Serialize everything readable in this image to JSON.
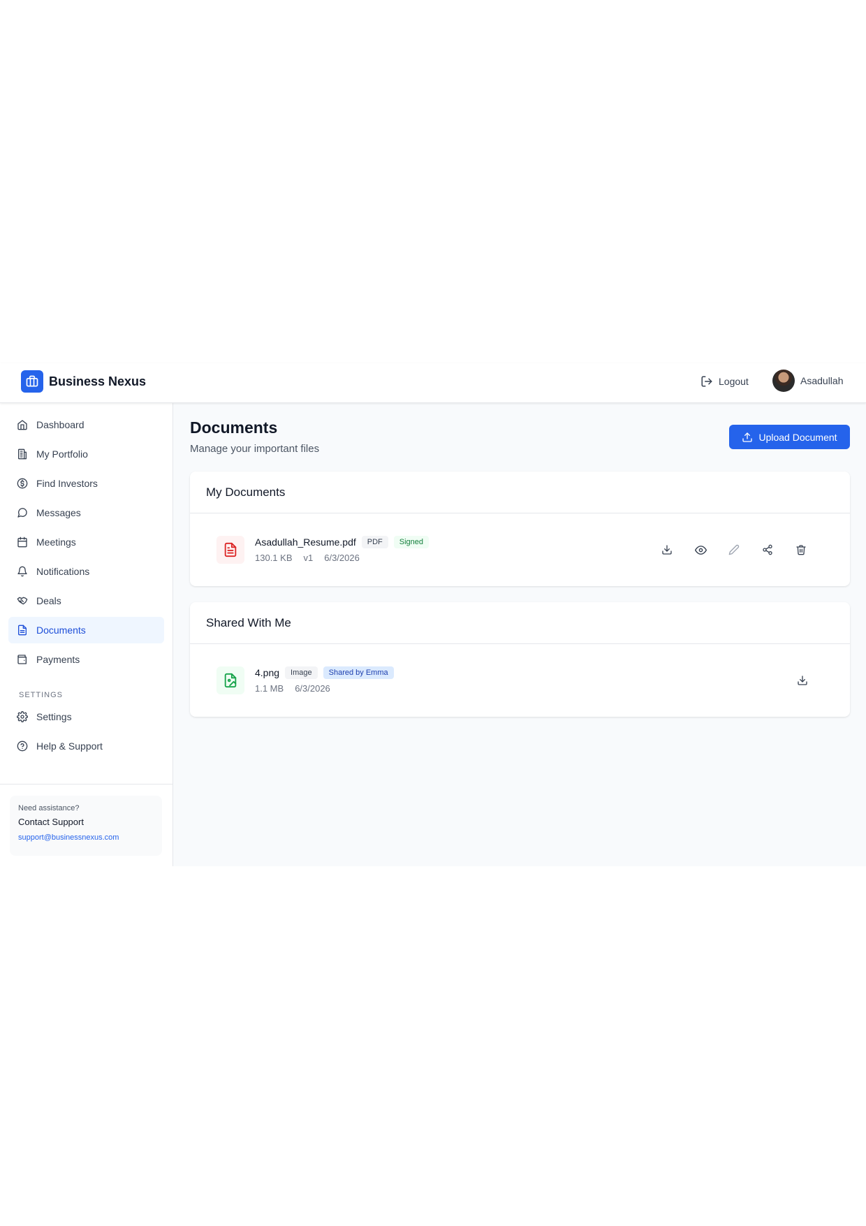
{
  "header": {
    "brand_name": "Business Nexus",
    "brand_icon": "briefcase-icon",
    "logout_label": "Logout",
    "user_name": "Asadullah"
  },
  "sidebar": {
    "items": [
      {
        "label": "Dashboard",
        "icon": "home-icon"
      },
      {
        "label": "My Portfolio",
        "icon": "building-icon"
      },
      {
        "label": "Find Investors",
        "icon": "dollar-circle-icon"
      },
      {
        "label": "Messages",
        "icon": "message-circle-icon"
      },
      {
        "label": "Meetings",
        "icon": "calendar-icon"
      },
      {
        "label": "Notifications",
        "icon": "bell-icon"
      },
      {
        "label": "Deals",
        "icon": "handshake-icon"
      },
      {
        "label": "Documents",
        "icon": "file-text-icon",
        "active": true
      },
      {
        "label": "Payments",
        "icon": "wallet-icon"
      }
    ],
    "settings_section_label": "SETTINGS",
    "settings_items": [
      {
        "label": "Settings",
        "icon": "gear-icon"
      },
      {
        "label": "Help & Support",
        "icon": "help-circle-icon"
      }
    ],
    "help": {
      "small": "Need assistance?",
      "title": "Contact Support",
      "email": "support@businessnexus.com"
    }
  },
  "main": {
    "title": "Documents",
    "subtitle": "Manage your important files",
    "upload_label": "Upload Document",
    "my_documents": {
      "title": "My Documents",
      "rows": [
        {
          "name": "Asadullah_Resume.pdf",
          "type_tag": "PDF",
          "status_tag": "Signed",
          "size": "130.1 KB",
          "version": "v1",
          "date": "6/3/2026",
          "actions": [
            "download-icon",
            "eye-icon",
            "pencil-icon",
            "share-icon",
            "trash-icon"
          ]
        }
      ]
    },
    "shared_with_me": {
      "title": "Shared With Me",
      "rows": [
        {
          "name": "4.png",
          "type_tag": "Image",
          "shared_tag": "Shared by Emma",
          "size": "1.1 MB",
          "date": "6/3/2026",
          "actions": [
            "download-icon"
          ]
        }
      ]
    }
  },
  "colors": {
    "accent": "#2563eb",
    "active_nav_bg": "#eff6ff",
    "pdf_icon": "#dc2626",
    "image_icon": "#16a34a",
    "signed_tag": "#15803d"
  }
}
